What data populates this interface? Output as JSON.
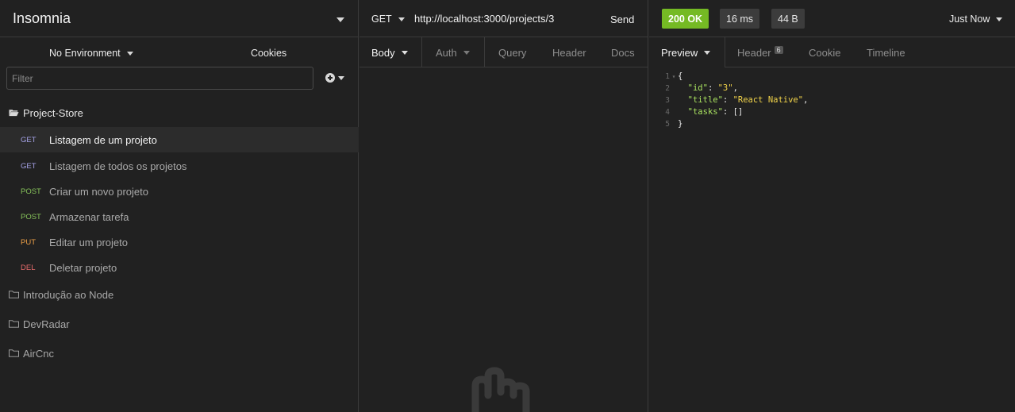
{
  "app": {
    "title": "Insomnia"
  },
  "sidebar": {
    "environment": "No Environment",
    "cookies_label": "Cookies",
    "filter_placeholder": "Filter",
    "workspace": "Project-Store",
    "requests": [
      {
        "method": "GET",
        "name": "Listagem de um projeto",
        "active": true
      },
      {
        "method": "GET",
        "name": "Listagem de todos os projetos"
      },
      {
        "method": "POST",
        "name": "Criar um novo projeto"
      },
      {
        "method": "POST",
        "name": "Armazenar tarefa"
      },
      {
        "method": "PUT",
        "name": "Editar um projeto"
      },
      {
        "method": "DEL",
        "name": "Deletar projeto"
      }
    ],
    "folders": [
      {
        "name": "Introdução ao Node"
      },
      {
        "name": "DevRadar"
      },
      {
        "name": "AirCnc"
      }
    ]
  },
  "request": {
    "method": "GET",
    "url": "http://localhost:3000/projects/3",
    "send_label": "Send",
    "tabs": [
      {
        "label": "Body",
        "active": true
      },
      {
        "label": "Auth"
      },
      {
        "label": "Query"
      },
      {
        "label": "Header"
      },
      {
        "label": "Docs"
      }
    ]
  },
  "response": {
    "status": "200 OK",
    "time": "16 ms",
    "size": "44 B",
    "when": "Just Now",
    "tabs": [
      {
        "label": "Preview",
        "active": true
      },
      {
        "label": "Header",
        "count": "6"
      },
      {
        "label": "Cookie"
      },
      {
        "label": "Timeline"
      }
    ],
    "body_lines": [
      {
        "n": "1",
        "text": "{"
      },
      {
        "n": "2",
        "key": "\"id\"",
        "value": "\"3\"",
        "trail": ","
      },
      {
        "n": "3",
        "key": "\"title\"",
        "value": "\"React Native\"",
        "trail": ","
      },
      {
        "n": "4",
        "key": "\"tasks\"",
        "value": "[]",
        "trail": ""
      },
      {
        "n": "5",
        "text": "}"
      }
    ]
  },
  "colors": {
    "status_ok": "#75ba24",
    "get": "#a5a2e6",
    "post": "#86c25a",
    "put": "#ec9f47",
    "del": "#e56b6b"
  }
}
